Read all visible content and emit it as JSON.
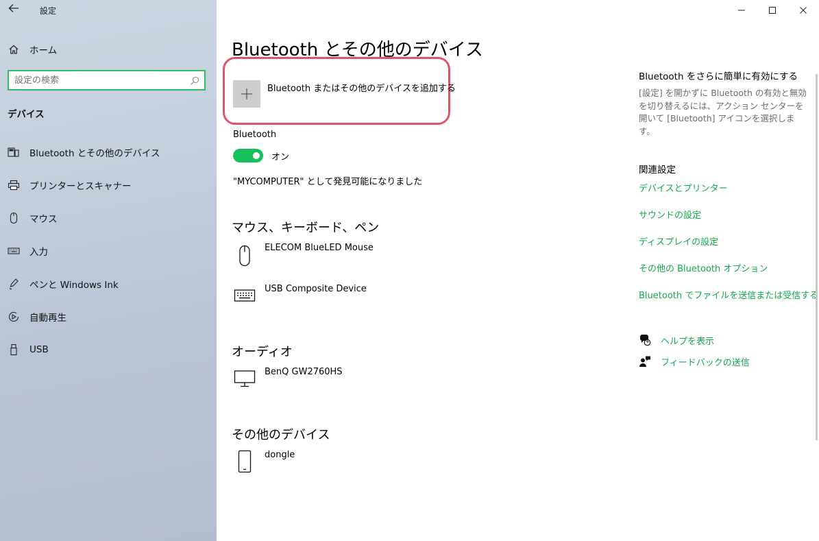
{
  "window": {
    "title": "設定",
    "back_icon": "back-arrow-icon",
    "minimize_glyph": "—",
    "maximize_glyph": "☐",
    "close_glyph": "✕"
  },
  "sidebar": {
    "home_label": "ホーム",
    "search_placeholder": "設定の検索",
    "section_title": "デバイス",
    "items": [
      {
        "label": "Bluetooth とその他のデバイス",
        "icon": "bluetooth-devices-icon"
      },
      {
        "label": "プリンターとスキャナー",
        "icon": "printer-icon"
      },
      {
        "label": "マウス",
        "icon": "mouse-icon"
      },
      {
        "label": "入力",
        "icon": "keyboard-icon"
      },
      {
        "label": "ペンと Windows Ink",
        "icon": "pen-icon"
      },
      {
        "label": "自動再生",
        "icon": "autoplay-icon"
      },
      {
        "label": "USB",
        "icon": "usb-icon"
      }
    ]
  },
  "main": {
    "title": "Bluetooth とその他のデバイス",
    "add_device_label": "Bluetooth またはその他のデバイスを追加する",
    "bluetooth_label": "Bluetooth",
    "toggle_state": "オン",
    "discoverable_text": "\"MYCOMPUTER\" として発見可能になりました",
    "groups": [
      {
        "heading": "マウス、キーボード、ペン",
        "devices": [
          {
            "name": "ELECOM BlueLED Mouse",
            "icon": "mouse-icon"
          },
          {
            "name": "USB Composite Device",
            "icon": "keyboard-icon"
          }
        ]
      },
      {
        "heading": "オーディオ",
        "devices": [
          {
            "name": "BenQ GW2760HS",
            "icon": "monitor-icon"
          }
        ]
      },
      {
        "heading": "その他のデバイス",
        "devices": [
          {
            "name": "dongle",
            "icon": "phone-icon"
          }
        ]
      }
    ]
  },
  "right": {
    "tip_title": "Bluetooth をさらに簡単に有効にする",
    "tip_text": "[設定] を開かずに Bluetooth の有効と無効を切り替えるには、アクション センターを開いて [Bluetooth] アイコンを選択します。",
    "related_title": "関連設定",
    "links": [
      "デバイスとプリンター",
      "サウンドの設定",
      "ディスプレイの設定",
      "その他の Bluetooth オプション",
      "Bluetooth でファイルを送信または受信する"
    ],
    "help_label": "ヘルプを表示",
    "feedback_label": "フィードバックの送信"
  },
  "colors": {
    "accent": "#0fa94a",
    "toggle_on": "#16c15b",
    "highlight": "#e05565",
    "search_border": "#2fbe5f"
  }
}
